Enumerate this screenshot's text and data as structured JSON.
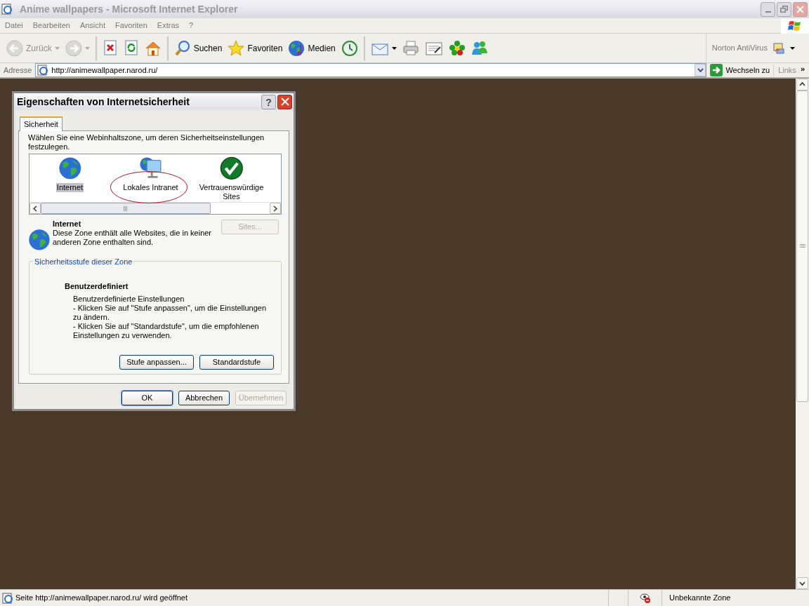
{
  "window": {
    "title": "Anime wallpapers - Microsoft Internet Explorer",
    "active": false
  },
  "menu": [
    "Datei",
    "Bearbeiten",
    "Ansicht",
    "Favoriten",
    "Extras",
    "?"
  ],
  "toolbar": [
    {
      "kind": "back",
      "label": "Zurück",
      "disabled": true,
      "dropdown": true
    },
    {
      "kind": "forward",
      "disabled": true,
      "dropdown": true
    },
    {
      "kind": "stop",
      "separator_before": true
    },
    {
      "kind": "refresh"
    },
    {
      "kind": "home"
    },
    {
      "kind": "search",
      "label": "Suchen",
      "separator_before": true
    },
    {
      "kind": "favorites",
      "label": "Favoriten"
    },
    {
      "kind": "media",
      "label": "Medien"
    },
    {
      "kind": "history"
    },
    {
      "kind": "mail",
      "dropdown": true,
      "separator_before": true
    },
    {
      "kind": "print"
    },
    {
      "kind": "edit"
    },
    {
      "kind": "icq"
    },
    {
      "kind": "messenger"
    }
  ],
  "norton": {
    "label": "Norton AntiVirus"
  },
  "address": {
    "label": "Adresse",
    "value": "http://animewallpaper.narod.ru/",
    "go": "Wechseln zu",
    "links": "Links",
    "more": "»"
  },
  "dialog": {
    "title": "Eigenschaften von Internetsicherheit",
    "help": "?",
    "tabs": [
      {
        "label": "Sicherheit",
        "selected": true
      }
    ],
    "instruction": "Wählen Sie eine Webinhaltszone, um deren Sicherheitseinstellungen festzulegen.",
    "zones": [
      {
        "kind": "internet",
        "label": "Internet",
        "selected": true,
        "circled": false
      },
      {
        "kind": "intranet",
        "label": "Lokales Intranet",
        "selected": false,
        "circled": true
      },
      {
        "kind": "trusted",
        "label": "Vertrauenswürdige Sites",
        "selected": false,
        "circled": false
      }
    ],
    "zone_info": {
      "name": "Internet",
      "description": "Diese Zone enthält alle Websites, die in keiner anderen Zone enthalten sind.",
      "sites_button": {
        "label": "Sites...",
        "disabled": true
      }
    },
    "level_group": {
      "title": "Sicherheitsstufe dieser Zone",
      "level": "Benutzerdefiniert",
      "lines": [
        "Benutzerdefinierte Einstellungen",
        "- Klicken Sie auf \"Stufe anpassen\", um die Einstellungen zu ändern.",
        "- Klicken Sie auf \"Standardstufe\", um die empfohlenen Einstellungen zu verwenden."
      ],
      "buttons": [
        {
          "label": "Stufe anpassen...",
          "disabled": false
        },
        {
          "label": "Standardstufe",
          "disabled": false
        }
      ]
    },
    "buttons": [
      {
        "label": "OK",
        "default": true,
        "disabled": false
      },
      {
        "label": "Abbrechen",
        "default": false,
        "disabled": false
      },
      {
        "label": "Übernehmen",
        "default": false,
        "disabled": true
      }
    ]
  },
  "status_bar": {
    "text": "Seite http://animewallpaper.narod.ru/ wird geöffnet",
    "zone": "Unbekannte Zone"
  }
}
